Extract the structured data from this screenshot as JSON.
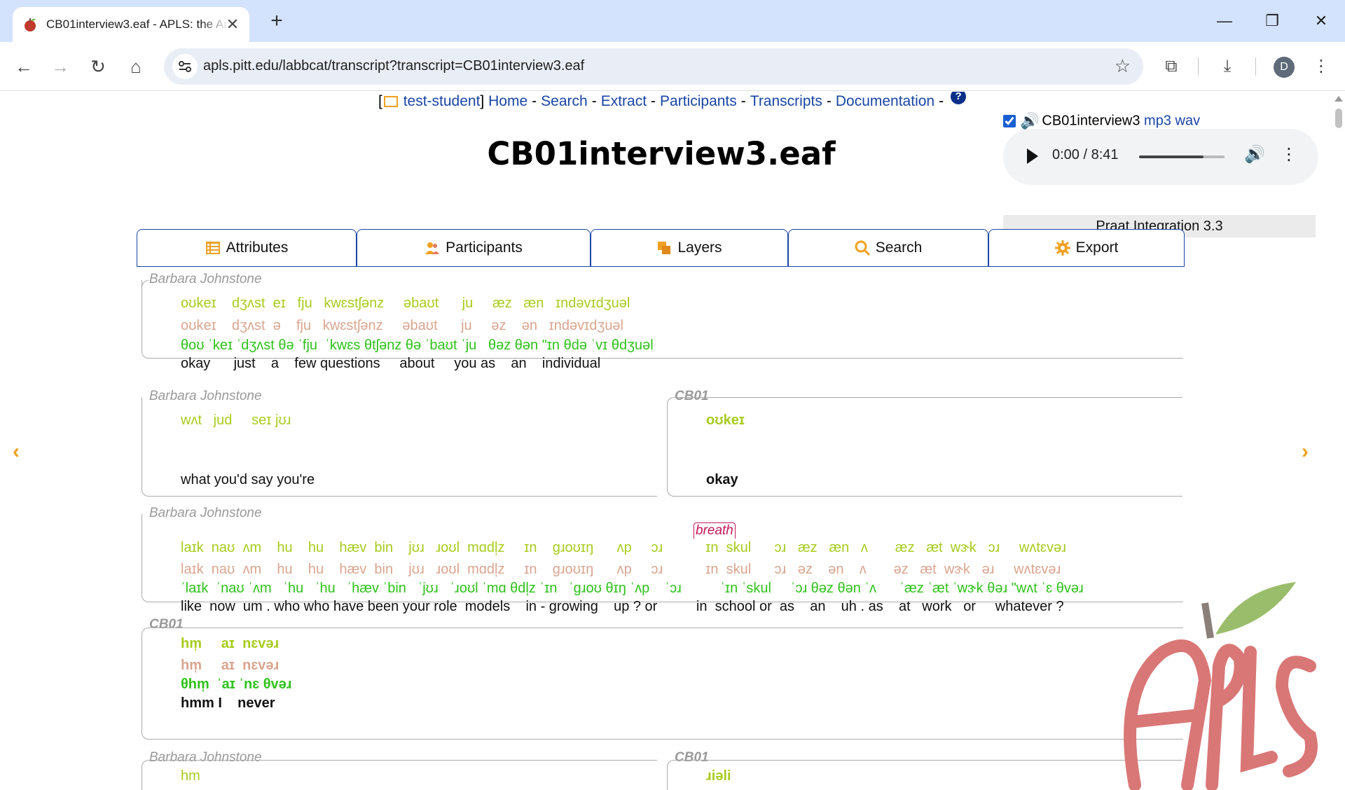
{
  "browser": {
    "tab_title": "CB01interview3.eaf - APLS: the Archive of Pittsburgh Language and Speech",
    "url": "apls.pitt.edu/labbcat/transcript?transcript=CB01interview3.eaf",
    "profile_initial": "D",
    "new_tab": "+",
    "close_tab": "✕"
  },
  "menu": {
    "open_bracket": "[",
    "user": "test-student",
    "close_bracket": "]",
    "items": [
      "Home",
      "Search",
      "Extract",
      "Participants",
      "Transcripts",
      "Documentation"
    ],
    "sep": "-",
    "help": "?"
  },
  "title": "CB01interview3.eaf",
  "media": {
    "transcript_name": "CB01interview3",
    "mp3": "mp3",
    "wav": "wav",
    "time": "0:00 / 8:41",
    "volume_level": 0.75,
    "praat": "Praat Integration 3.3"
  },
  "tabs": [
    "Attributes",
    "Participants",
    "Layers",
    "Search",
    "Export"
  ],
  "utterances": [
    {
      "speaker": "Barbara Johnstone",
      "tiers": [
        "oʊkeɪ    dʒʌst  eɪ   fju   kwɛstʃənz     əbaʊt      ju     æz   æn   ɪndəvɪdʒuəl",
        "oʊkeɪ    dʒʌst  ə    fju   kwɛstʃənz     əbaʊt      ju     əz    ən   ɪndəvɪdʒuəl",
        "θoʊ ˈkeɪ ˈdʒʌst θə ˈfju  ˈkwɛs θtʃənz θə ˈbaʊt ˈju   θəz θən \"ɪn θdə ˈvɪ θdʒuəl",
        "okay      just    a    few questions     about     you as    an    individual"
      ]
    },
    {
      "speaker": "Barbara Johnstone",
      "tiers": [
        "wʌt   jud     seɪ jʊɹ",
        "",
        "",
        "what you'd say you're"
      ]
    },
    {
      "speaker": "CB01",
      "tiers": [
        "oʊkeɪ",
        "",
        "",
        "okay"
      ]
    },
    {
      "speaker": "Barbara Johnstone",
      "event": "breath",
      "tiers": [
        "laɪk  naʊ  ʌm    hu    hu    hæv  bin    jʊɹ   ɹoʊl  mɑdl̩z     ɪn    ɡɹoʊɪŋ      ʌp     ɔɹ           ɪn  skul      ɔɹ   æz   æn   ʌ       æz   æt  wɝk   ɔɹ     wʌtɛvəɹ",
        "laɪk  naʊ  ʌm    hu    hu    hæv  bin    jʊɹ   ɹoʊl  mɑdl̩z     ɪn    ɡɹoʊɪŋ      ʌp     ɔɹ           ɪn  skul      ɔɹ   əz    ən    ʌ       əz   æt  wɝk   əɹ     wʌtɛvəɹ",
        "ˈlaɪk  ˈnaʊ ˈʌm   ˈhu   ˈhu   ˈhæv ˈbin   ˈjʊɹ   ˈɹoʊl ˈmɑ θdl̩z ˈɪn   ˈɡɹoʊ θɪŋ ˈʌp    ˈɔɹ          ˈɪn ˈskul     ˈɔɹ θəz θən ˈʌ      ˈæz ˈæt ˈwɝk θəɹ \"wʌt ˈɛ θvəɹ",
        "like  now  um . who who have been your role  models    in - growing    up ? or          in  school or  as    an    uh . as    at   work   or     whatever ?"
      ]
    },
    {
      "speaker": "CB01",
      "tiers": [
        "hm̩     aɪ  nɛvəɹ",
        "hm̩     aɪ  nɛvəɹ",
        "θhm̩  ˈaɪ ˈnɛ θvəɹ",
        "hmm I    never"
      ]
    },
    {
      "speaker": "Barbara Johnstone",
      "tiers": [
        "hm",
        "",
        "",
        ""
      ]
    },
    {
      "speaker": "CB01",
      "tiers": [
        "ɹiəli",
        "",
        "",
        ""
      ]
    }
  ]
}
